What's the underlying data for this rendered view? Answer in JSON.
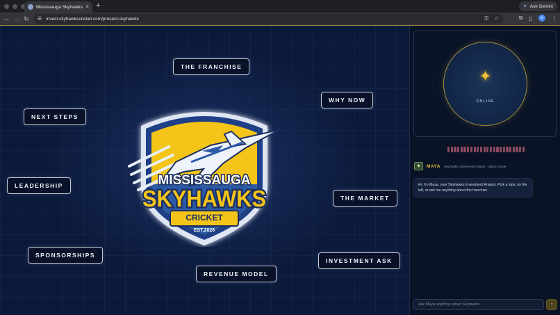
{
  "browser": {
    "tab_title": "Mississauga Skyhawks — Inv…",
    "tab_close": "×",
    "new_tab": "+",
    "ask_gemini": "Ask Gemini",
    "url": "invest.skyhawkscricket.com/present-skyhawks",
    "profile_initial": "x"
  },
  "topics": {
    "franchise": "THE FRANCHISE",
    "why_now": "WHY NOW",
    "next_steps": "NEXT STEPS",
    "leadership": "LEADERSHIP",
    "market": "THE MARKET",
    "sponsorships": "SPONSORSHIPS",
    "investment_ask": "INVESTMENT ASK",
    "revenue_model": "REVENUE MODEL"
  },
  "logo": {
    "line1": "MISSISSAUGA",
    "line2": "SKYHAWKS",
    "line3": "CRICKET",
    "line4": "EST.2026"
  },
  "sidebar": {
    "orb_status": "ONLINE",
    "agent_name": "MAYA",
    "agent_subtitle": "Skyhawks Investment Analyst · classic mode",
    "message": "Hi, I'm Maya, your Skyhawks Investment Analyst. Pick a topic on the left, or ask me anything about the franchise.",
    "input_placeholder": "Ask Maya anything about Skyhawks…"
  },
  "colors": {
    "accent_gold": "#e2b93b",
    "logo_yellow": "#f4c418",
    "logo_blue": "#2f5ba8",
    "background_navy": "#0c1a3a"
  }
}
